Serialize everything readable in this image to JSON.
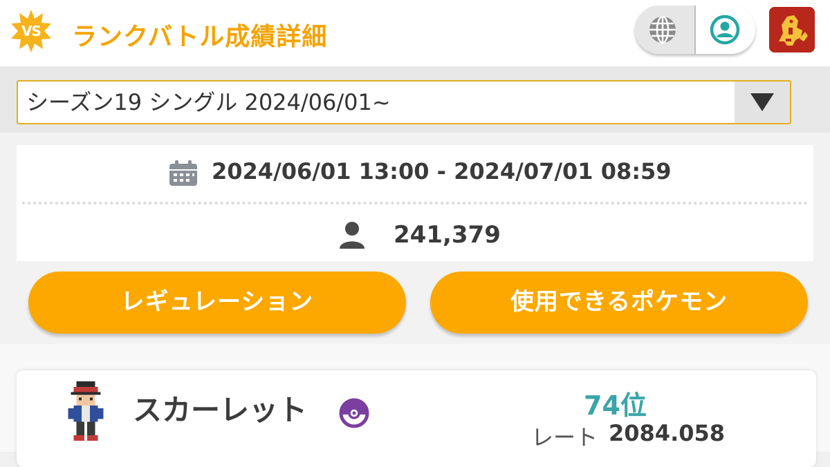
{
  "header": {
    "badge_text": "VS",
    "title": "ランクバトル成績詳細",
    "icons": [
      "globe-icon",
      "account-icon",
      "trainer-avatar"
    ],
    "accent_color": "#f5a300"
  },
  "season_select": {
    "selected": "シーズン19 シングル 2024/06/01~",
    "arrow_icon": "chevron-down-icon"
  },
  "season_info": {
    "period": "2024/06/01 13:00 - 2024/07/01 08:59",
    "players": "241,379",
    "period_icon": "calendar-icon",
    "players_icon": "person-icon"
  },
  "buttons": {
    "regulation": "レギュレーション",
    "usable_pokemon": "使用できるポケモン",
    "color": "#fca800"
  },
  "player": {
    "name": "スカーレット",
    "version_icon": "poke-ball-icon",
    "rank": "74位",
    "rate_label": "レート",
    "rate_value": "2084.058",
    "rank_color": "#3aa5a8"
  }
}
